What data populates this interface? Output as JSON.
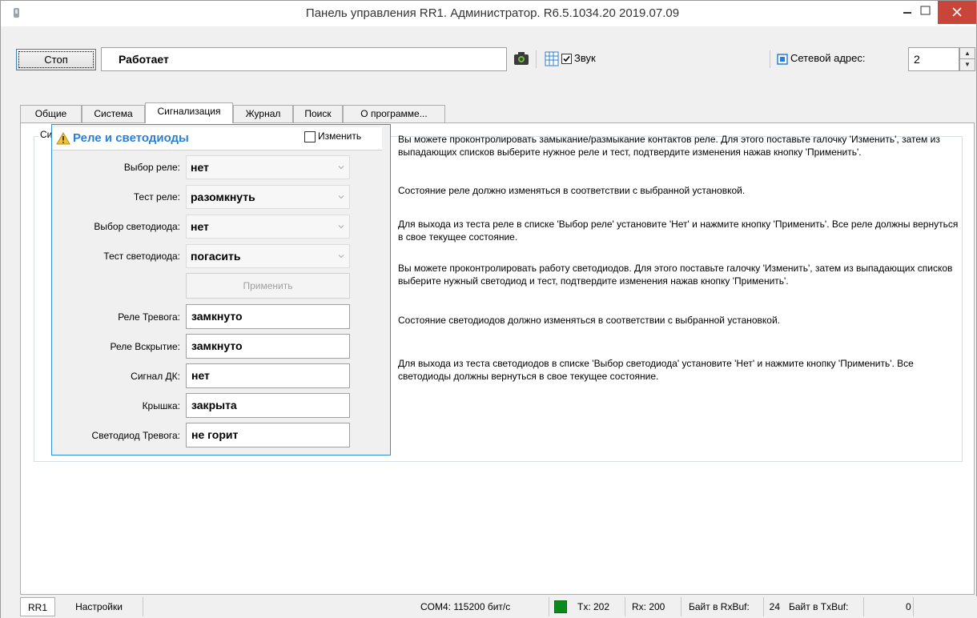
{
  "window": {
    "title": "Панель управления RR1. Администратор. R6.5.1034.20 2019.07.09"
  },
  "toolbar": {
    "stop_label": "Стоп",
    "status": "Работает",
    "sound_label": "Звук",
    "sound_checked": true,
    "net_address_label": "Сетевой адрес:",
    "net_address_value": "2"
  },
  "tabs": [
    {
      "label": "Общие"
    },
    {
      "label": "Система"
    },
    {
      "label": "Сигнализация",
      "active": true
    },
    {
      "label": "Журнал"
    },
    {
      "label": "Поиск"
    },
    {
      "label": "О программе..."
    }
  ],
  "group": {
    "label": "Сигнализация"
  },
  "relay": {
    "title": "Реле и светодиоды",
    "edit_label": "Изменить",
    "edit_checked": false,
    "select_relay_label": "Выбор реле:",
    "select_relay_value": "нет",
    "test_relay_label": "Тест реле:",
    "test_relay_value": "разомкнуть",
    "select_led_label": "Выбор светодиода:",
    "select_led_value": "нет",
    "test_led_label": "Тест светодиода:",
    "test_led_value": "погасить",
    "apply_label": "Применить",
    "alarm_relay_label": "Реле Тревога:",
    "alarm_relay_value": "замкнуто",
    "tamper_relay_label": "Реле Вскрытие:",
    "tamper_relay_value": "замкнуто",
    "dk_signal_label": "Сигнал ДК:",
    "dk_signal_value": "нет",
    "cover_label": "Крышка:",
    "cover_value": "закрыта",
    "alarm_led_label": "Светодиод Тревога:",
    "alarm_led_value": "не горит"
  },
  "help": {
    "p1": "Вы можете проконтролировать замыкание/размыкание контактов реле. Для этого поставьте галочку 'Изменить', затем из выпадающих списков выберите нужное реле и тест, подтвердите изменения нажав кнопку 'Применить'.",
    "p2": "Состояние реле должно изменяться в соответствии с выбранной установкой.",
    "p3": "Для выхода из теста реле в списке 'Выбор реле' установите 'Нет' и нажмите кнопку 'Применить'. Все реле должны вернуться в свое текущее состояние.",
    "p4": "Вы можете проконтролировать работу светодиодов. Для этого поставьте галочку 'Изменить', затем из выпадающих списков выберите нужный светодиод и тест, подтвердите изменения нажав кнопку 'Применить'.",
    "p5": "Состояние светодиодов должно изменяться в соответствии с выбранной установкой.",
    "p6": "Для выхода из теста светодиодов в списке 'Выбор светодиода' установите 'Нет' и нажмите кнопку 'Применить'. Все светодиоды должны вернуться в свое текущее состояние."
  },
  "statusbar": {
    "device": "RR1",
    "settings": "Настройки",
    "port": "COM4: 115200 бит/с",
    "tx": "Tx: 202",
    "rx": "Rx: 200",
    "rxbuf_label": "Байт в RxBuf:",
    "rxbuf_value": "24",
    "txbuf_label": "Байт в TxBuf:",
    "txbuf_value": "0",
    "connection_color": "#0a8a1a"
  },
  "icons": {
    "app": "app-icon",
    "camera": "camera-icon",
    "grid": "grid-icon",
    "network": "network-icon",
    "warning": "warning-icon"
  }
}
